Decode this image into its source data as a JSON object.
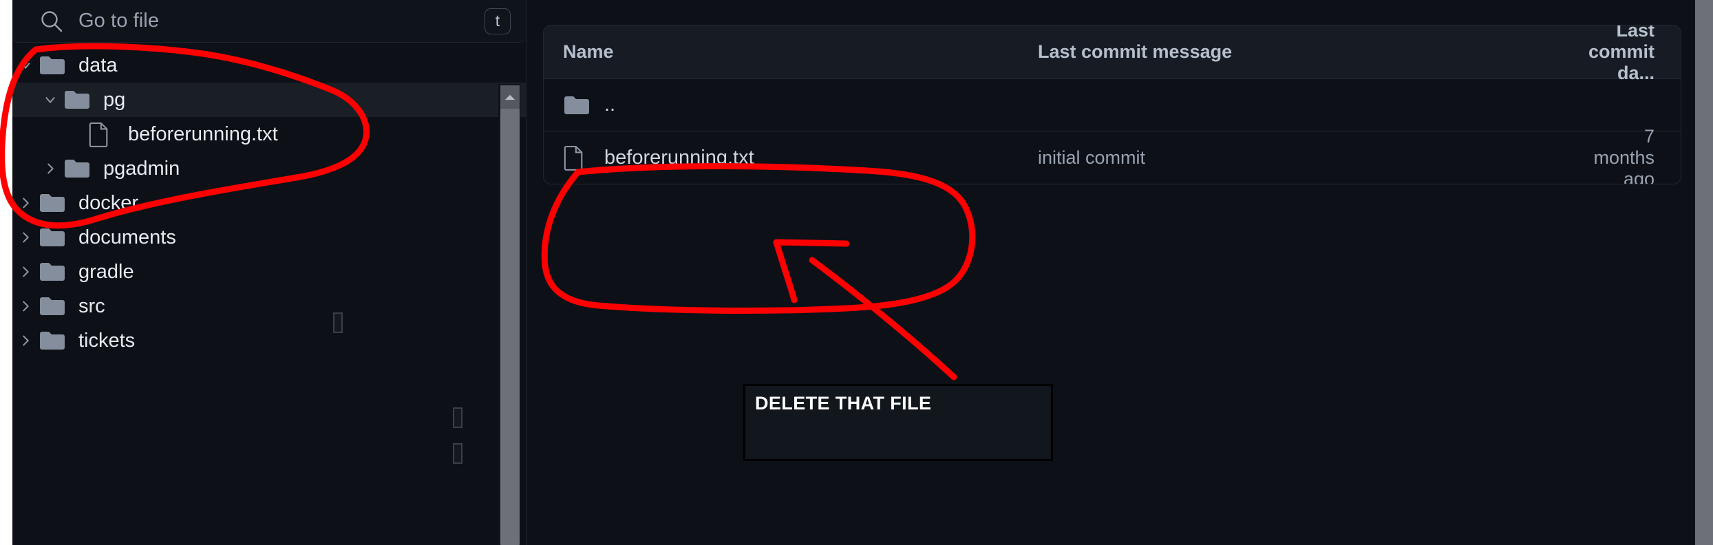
{
  "colors": {
    "background": "#0d1017",
    "panel_header": "#171c24",
    "selected_row": "#1a1f26",
    "border": "#222731",
    "annotation_red": "#fe0000",
    "text_primary": "#e7ebf1",
    "text_muted": "#99a2af",
    "scrollbar": "#6d7078"
  },
  "search": {
    "icon": "search-icon",
    "placeholder": "Go to file",
    "shortcut_badge": "t"
  },
  "sidebar": {
    "items": [
      {
        "label": "data",
        "level": 0,
        "type": "folder",
        "chevron": "chevron-down",
        "selected": false
      },
      {
        "label": "pg",
        "level": 1,
        "type": "folder",
        "chevron": "chevron-down",
        "selected": true
      },
      {
        "label": "beforerunning.txt",
        "level": 2,
        "type": "file",
        "chevron": "none",
        "selected": false
      },
      {
        "label": "pgadmin",
        "level": 1,
        "type": "folder",
        "chevron": "chevron-right",
        "selected": false
      },
      {
        "label": "docker",
        "level": 0,
        "type": "folder",
        "chevron": "chevron-right",
        "selected": false
      },
      {
        "label": "documents",
        "level": 0,
        "type": "folder",
        "chevron": "chevron-right",
        "selected": false
      },
      {
        "label": "gradle",
        "level": 0,
        "type": "folder",
        "chevron": "chevron-right",
        "selected": false
      },
      {
        "label": "src",
        "level": 0,
        "type": "folder",
        "chevron": "chevron-right",
        "selected": false
      },
      {
        "label": "tickets",
        "level": 0,
        "type": "folder",
        "chevron": "chevron-right",
        "selected": false
      }
    ]
  },
  "file_table": {
    "headers": {
      "name": "Name",
      "message": "Last commit message",
      "date": "Last commit da..."
    },
    "rows": [
      {
        "name": "..",
        "icon": "folder-icon",
        "message": "",
        "date": ""
      },
      {
        "name": "beforerunning.txt",
        "icon": "file-icon",
        "message": "initial commit",
        "date": "7 months ago"
      }
    ]
  },
  "annotation": {
    "note_text": "DELETE THAT FILE",
    "marks": [
      "circle-around-sidebar-data-pg-beforerunning",
      "circle-around-file-row-beforerunning",
      "arrow-from-note-to-file-row"
    ]
  }
}
